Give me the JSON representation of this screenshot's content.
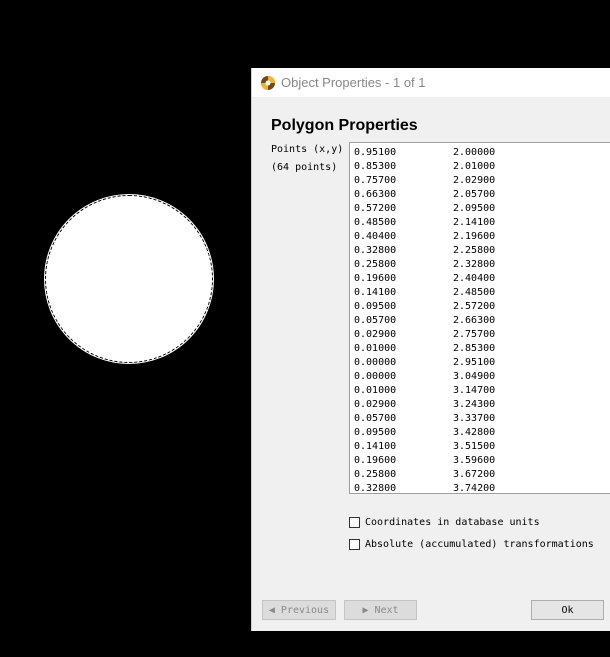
{
  "dialog": {
    "title": "Object Properties - 1 of 1",
    "heading": "Polygon Properties",
    "points_label": "Points (x,y)",
    "points_count": "(64 points)",
    "points": [
      [
        "0.95100",
        "2.00000"
      ],
      [
        "0.85300",
        "2.01000"
      ],
      [
        "0.75700",
        "2.02900"
      ],
      [
        "0.66300",
        "2.05700"
      ],
      [
        "0.57200",
        "2.09500"
      ],
      [
        "0.48500",
        "2.14100"
      ],
      [
        "0.40400",
        "2.19600"
      ],
      [
        "0.32800",
        "2.25800"
      ],
      [
        "0.25800",
        "2.32800"
      ],
      [
        "0.19600",
        "2.40400"
      ],
      [
        "0.14100",
        "2.48500"
      ],
      [
        "0.09500",
        "2.57200"
      ],
      [
        "0.05700",
        "2.66300"
      ],
      [
        "0.02900",
        "2.75700"
      ],
      [
        "0.01000",
        "2.85300"
      ],
      [
        "0.00000",
        "2.95100"
      ],
      [
        "0.00000",
        "3.04900"
      ],
      [
        "0.01000",
        "3.14700"
      ],
      [
        "0.02900",
        "3.24300"
      ],
      [
        "0.05700",
        "3.33700"
      ],
      [
        "0.09500",
        "3.42800"
      ],
      [
        "0.14100",
        "3.51500"
      ],
      [
        "0.19600",
        "3.59600"
      ],
      [
        "0.25800",
        "3.67200"
      ],
      [
        "0.32800",
        "3.74200"
      ]
    ],
    "checkbox_db_units": "Coordinates in database units",
    "checkbox_abs_transform": "Absolute (accumulated) transformations",
    "btn_previous": "Previous",
    "btn_next": "Next",
    "btn_ok": "Ok"
  },
  "colors": {
    "background": "#000000",
    "dialog_bg": "#f0f0f0",
    "shape_fill": "#ffffff"
  }
}
